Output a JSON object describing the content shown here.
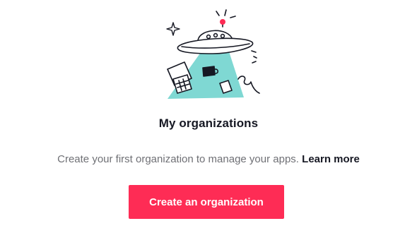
{
  "empty_state": {
    "illustration_icon": "ufo-abduction-illustration",
    "title": "My organizations",
    "description": "Create your first organization to manage your apps.",
    "learn_more_link": "Learn more",
    "create_button": "Create an organization"
  },
  "colors": {
    "primary": "#fe2c55",
    "beam": "#7fd8d3",
    "text_primary": "#161823",
    "text_secondary": "#6f7075"
  }
}
